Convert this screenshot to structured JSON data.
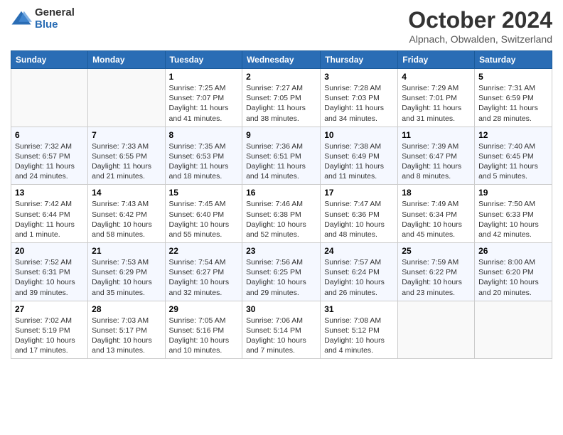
{
  "logo": {
    "general": "General",
    "blue": "Blue"
  },
  "title": "October 2024",
  "location": "Alpnach, Obwalden, Switzerland",
  "days": [
    "Sunday",
    "Monday",
    "Tuesday",
    "Wednesday",
    "Thursday",
    "Friday",
    "Saturday"
  ],
  "weeks": [
    [
      {
        "date": "",
        "info": ""
      },
      {
        "date": "",
        "info": ""
      },
      {
        "date": "1",
        "info": "Sunrise: 7:25 AM\nSunset: 7:07 PM\nDaylight: 11 hours and 41 minutes."
      },
      {
        "date": "2",
        "info": "Sunrise: 7:27 AM\nSunset: 7:05 PM\nDaylight: 11 hours and 38 minutes."
      },
      {
        "date": "3",
        "info": "Sunrise: 7:28 AM\nSunset: 7:03 PM\nDaylight: 11 hours and 34 minutes."
      },
      {
        "date": "4",
        "info": "Sunrise: 7:29 AM\nSunset: 7:01 PM\nDaylight: 11 hours and 31 minutes."
      },
      {
        "date": "5",
        "info": "Sunrise: 7:31 AM\nSunset: 6:59 PM\nDaylight: 11 hours and 28 minutes."
      }
    ],
    [
      {
        "date": "6",
        "info": "Sunrise: 7:32 AM\nSunset: 6:57 PM\nDaylight: 11 hours and 24 minutes."
      },
      {
        "date": "7",
        "info": "Sunrise: 7:33 AM\nSunset: 6:55 PM\nDaylight: 11 hours and 21 minutes."
      },
      {
        "date": "8",
        "info": "Sunrise: 7:35 AM\nSunset: 6:53 PM\nDaylight: 11 hours and 18 minutes."
      },
      {
        "date": "9",
        "info": "Sunrise: 7:36 AM\nSunset: 6:51 PM\nDaylight: 11 hours and 14 minutes."
      },
      {
        "date": "10",
        "info": "Sunrise: 7:38 AM\nSunset: 6:49 PM\nDaylight: 11 hours and 11 minutes."
      },
      {
        "date": "11",
        "info": "Sunrise: 7:39 AM\nSunset: 6:47 PM\nDaylight: 11 hours and 8 minutes."
      },
      {
        "date": "12",
        "info": "Sunrise: 7:40 AM\nSunset: 6:45 PM\nDaylight: 11 hours and 5 minutes."
      }
    ],
    [
      {
        "date": "13",
        "info": "Sunrise: 7:42 AM\nSunset: 6:44 PM\nDaylight: 11 hours and 1 minute."
      },
      {
        "date": "14",
        "info": "Sunrise: 7:43 AM\nSunset: 6:42 PM\nDaylight: 10 hours and 58 minutes."
      },
      {
        "date": "15",
        "info": "Sunrise: 7:45 AM\nSunset: 6:40 PM\nDaylight: 10 hours and 55 minutes."
      },
      {
        "date": "16",
        "info": "Sunrise: 7:46 AM\nSunset: 6:38 PM\nDaylight: 10 hours and 52 minutes."
      },
      {
        "date": "17",
        "info": "Sunrise: 7:47 AM\nSunset: 6:36 PM\nDaylight: 10 hours and 48 minutes."
      },
      {
        "date": "18",
        "info": "Sunrise: 7:49 AM\nSunset: 6:34 PM\nDaylight: 10 hours and 45 minutes."
      },
      {
        "date": "19",
        "info": "Sunrise: 7:50 AM\nSunset: 6:33 PM\nDaylight: 10 hours and 42 minutes."
      }
    ],
    [
      {
        "date": "20",
        "info": "Sunrise: 7:52 AM\nSunset: 6:31 PM\nDaylight: 10 hours and 39 minutes."
      },
      {
        "date": "21",
        "info": "Sunrise: 7:53 AM\nSunset: 6:29 PM\nDaylight: 10 hours and 35 minutes."
      },
      {
        "date": "22",
        "info": "Sunrise: 7:54 AM\nSunset: 6:27 PM\nDaylight: 10 hours and 32 minutes."
      },
      {
        "date": "23",
        "info": "Sunrise: 7:56 AM\nSunset: 6:25 PM\nDaylight: 10 hours and 29 minutes."
      },
      {
        "date": "24",
        "info": "Sunrise: 7:57 AM\nSunset: 6:24 PM\nDaylight: 10 hours and 26 minutes."
      },
      {
        "date": "25",
        "info": "Sunrise: 7:59 AM\nSunset: 6:22 PM\nDaylight: 10 hours and 23 minutes."
      },
      {
        "date": "26",
        "info": "Sunrise: 8:00 AM\nSunset: 6:20 PM\nDaylight: 10 hours and 20 minutes."
      }
    ],
    [
      {
        "date": "27",
        "info": "Sunrise: 7:02 AM\nSunset: 5:19 PM\nDaylight: 10 hours and 17 minutes."
      },
      {
        "date": "28",
        "info": "Sunrise: 7:03 AM\nSunset: 5:17 PM\nDaylight: 10 hours and 13 minutes."
      },
      {
        "date": "29",
        "info": "Sunrise: 7:05 AM\nSunset: 5:16 PM\nDaylight: 10 hours and 10 minutes."
      },
      {
        "date": "30",
        "info": "Sunrise: 7:06 AM\nSunset: 5:14 PM\nDaylight: 10 hours and 7 minutes."
      },
      {
        "date": "31",
        "info": "Sunrise: 7:08 AM\nSunset: 5:12 PM\nDaylight: 10 hours and 4 minutes."
      },
      {
        "date": "",
        "info": ""
      },
      {
        "date": "",
        "info": ""
      }
    ]
  ]
}
